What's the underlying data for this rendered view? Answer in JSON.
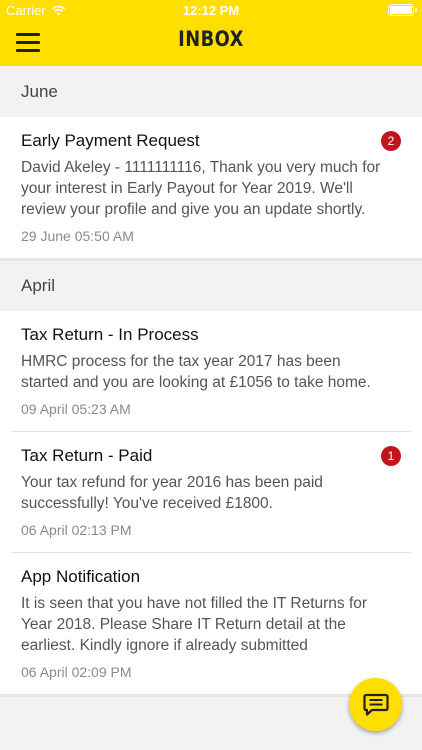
{
  "status_bar": {
    "carrier": "Carrier",
    "time": "12:12 PM",
    "icons": [
      "wifi-icon",
      "battery-icon"
    ]
  },
  "header": {
    "title": "INBOX",
    "menu_icon": "hamburger-menu-icon",
    "background_color": "#ffde00"
  },
  "sections": [
    {
      "label": "June",
      "messages": [
        {
          "title": "Early Payment Request",
          "body": "David Akeley - 1111111116, Thank you very much for your interest in Early Payout for Year 2019. We'll review your profile and give you an update shortly.",
          "date": "29 June 05:50 AM",
          "badge": "2"
        }
      ]
    },
    {
      "label": "April",
      "messages": [
        {
          "title": "Tax Return - In Process",
          "body": "HMRC process for the tax year 2017 has been started and you are looking at £1056 to take home.",
          "date": "09 April 05:23 AM",
          "badge": ""
        },
        {
          "title": "Tax Return - Paid",
          "body": "Your tax refund for year 2016 has been paid successfully! You've received £1800.",
          "date": "06 April 02:13 PM",
          "badge": "1"
        },
        {
          "title": "App Notification",
          "body": "It is seen that you have not filled the IT Returns for Year 2018. Please Share IT Return detail at the earliest. Kindly ignore if already submitted",
          "date": "06 April 02:09 PM",
          "badge": ""
        }
      ]
    }
  ],
  "fab": {
    "icon": "chat-icon"
  },
  "colors": {
    "accent": "#ffde00",
    "badge": "#c0151c"
  }
}
